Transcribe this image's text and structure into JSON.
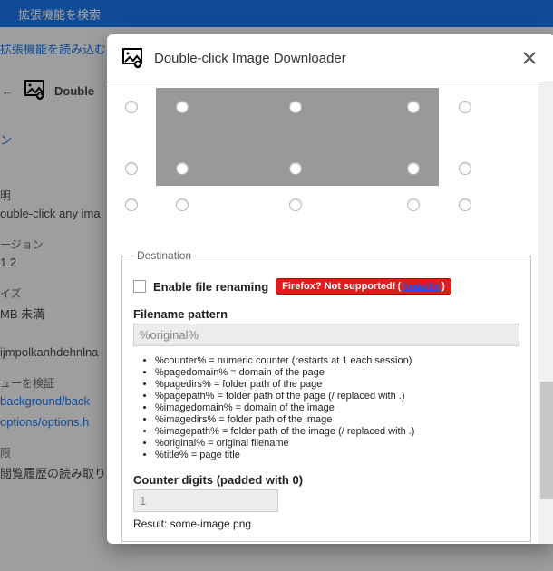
{
  "topbar": {
    "search_placeholder": "拡張機能を検索"
  },
  "background": {
    "load_link": "拡張機能を読み込む",
    "ext_name_short": "Double",
    "desc_h": "明",
    "desc_text": "ouble-click any ima",
    "version_h": "ージョン",
    "version_val": "1.2",
    "size_h": "イズ",
    "size_val": "MB 未満",
    "id_val": "ijmpolkanhdehnlna",
    "views_h": "ューを検証",
    "view1": "background/back",
    "view2": "options/options.h",
    "perm_h": "限",
    "perm1": "閲覧履歴の読み取り",
    "option_label": "ン"
  },
  "modal": {
    "title": "Double-click Image Downloader",
    "destination": {
      "legend": "Destination",
      "enable_label": "Enable file renaming",
      "warn_text": "Firefox? Not supported! ",
      "warn_link": "bugzilla",
      "filename_label": "Filename pattern",
      "filename_value": "%original%",
      "placeholders": [
        "%counter% = numeric counter (restarts at 1 each session)",
        "%pagedomain% = domain of the page",
        "%pagedirs% = folder path of the page",
        "%pagepath% = folder path of the page (/ replaced with .)",
        "%imagedomain% = domain of the image",
        "%imagedirs% = folder path of the image",
        "%imagepath% = folder path of the image (/ replaced with .)",
        "%original% = original filename",
        "%title% = page title"
      ],
      "counter_label": "Counter digits (padded with 0)",
      "counter_value": "1",
      "result_text": "Result: some-image.png"
    }
  }
}
